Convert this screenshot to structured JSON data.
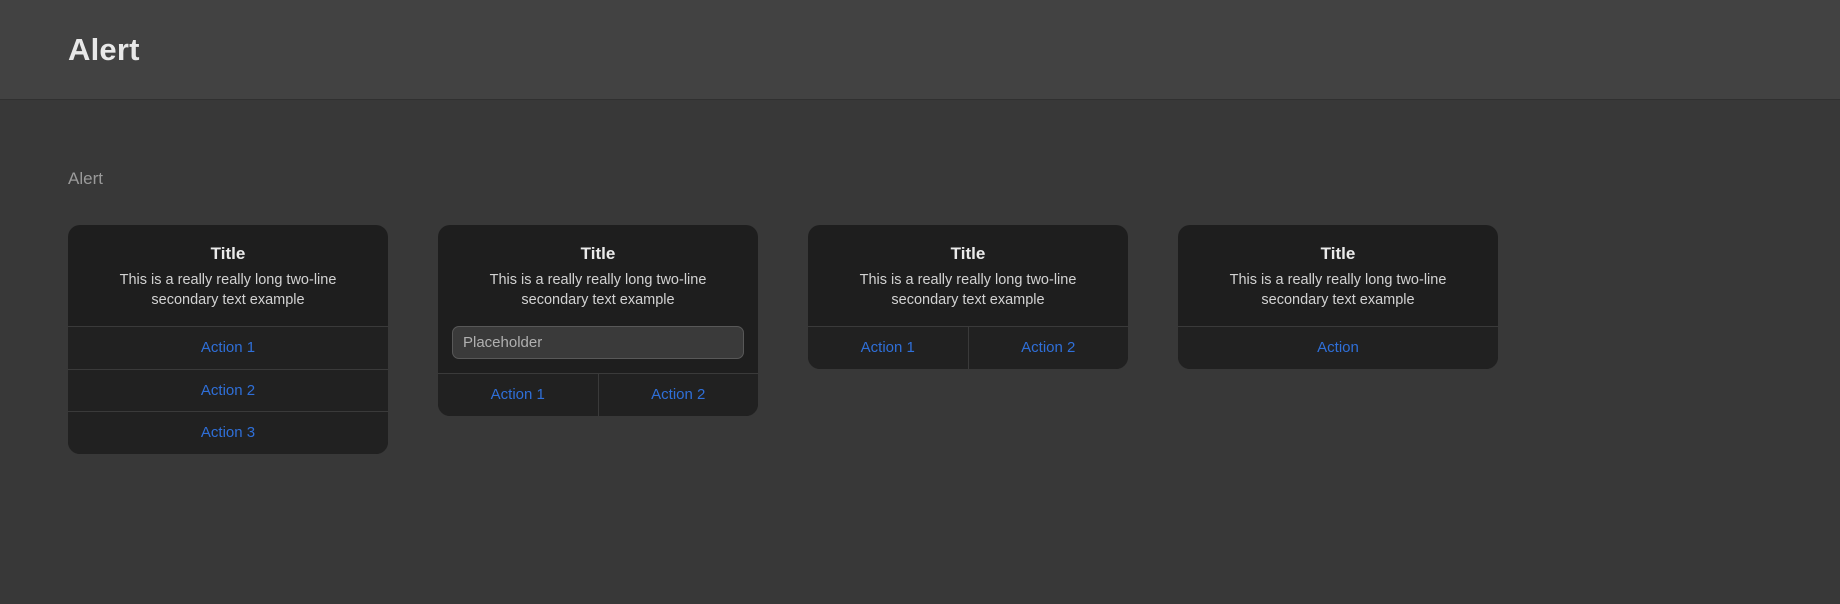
{
  "header": {
    "title": "Alert"
  },
  "section": {
    "label": "Alert"
  },
  "colors": {
    "page_background": "#383838",
    "header_background": "#424242",
    "card_background": "#1e1e1e",
    "action_text": "#2f6fd8",
    "title_text": "#eaeaea",
    "message_text": "#d2d2d2",
    "section_label_text": "#9a9a9a",
    "separator": "#3a3a3a"
  },
  "cards": [
    {
      "title": "Title",
      "message": "This is a really really long two-line secondary text example",
      "actions_layout": "stacked",
      "actions": [
        {
          "label": "Action 1"
        },
        {
          "label": "Action 2"
        },
        {
          "label": "Action 3"
        }
      ]
    },
    {
      "title": "Title",
      "message": "This is a really really long two-line secondary text example",
      "input": {
        "value": "",
        "placeholder": "Placeholder"
      },
      "actions_layout": "row",
      "actions": [
        {
          "label": "Action 1"
        },
        {
          "label": "Action 2"
        }
      ]
    },
    {
      "title": "Title",
      "message": "This is a really really long two-line secondary text example",
      "actions_layout": "row",
      "actions": [
        {
          "label": "Action 1"
        },
        {
          "label": "Action 2"
        }
      ]
    },
    {
      "title": "Title",
      "message": "This is a really really long two-line secondary text example",
      "actions_layout": "row",
      "actions": [
        {
          "label": "Action"
        }
      ]
    }
  ]
}
